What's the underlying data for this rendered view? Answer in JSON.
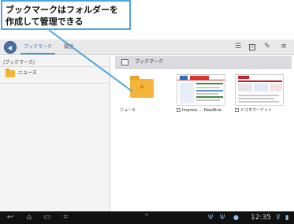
{
  "callout": {
    "line1": "ブックマークはフォルダーを",
    "line2": "作成して管理できる"
  },
  "browser": {
    "tabs": [
      {
        "label": "ブックマーク",
        "active": true
      },
      {
        "label": "履歴",
        "active": false
      }
    ],
    "toolbar_icons": [
      "list-view-icon",
      "save-page-icon",
      "edit-icon",
      "menu-icon"
    ]
  },
  "left_pane": {
    "path": "/ブックマーク/",
    "folder_label": "ニュース"
  },
  "right_pane": {
    "section_label": "ブックマーク",
    "items": [
      {
        "label": "ニュース",
        "kind": "folder"
      },
      {
        "label": "Impress ... Headline",
        "kind": "bookmark"
      },
      {
        "label": "ドコモマーケット",
        "kind": "bookmark"
      }
    ]
  },
  "system_bar": {
    "time": "12:35",
    "nav_icons": [
      "back-nav-icon",
      "home-nav-icon",
      "recent-apps-icon",
      "screenshot-icon",
      "up-arrow-icon"
    ],
    "status_icons": [
      "usb-icon",
      "usb-debug-icon",
      "battery-saver-icon",
      "signal-icon",
      "battery-icon"
    ]
  },
  "colors": {
    "accent": "#3a9ad9",
    "callout_border": "#4aa6df",
    "folder": "#f4b53a",
    "system_bar": "#111111"
  }
}
